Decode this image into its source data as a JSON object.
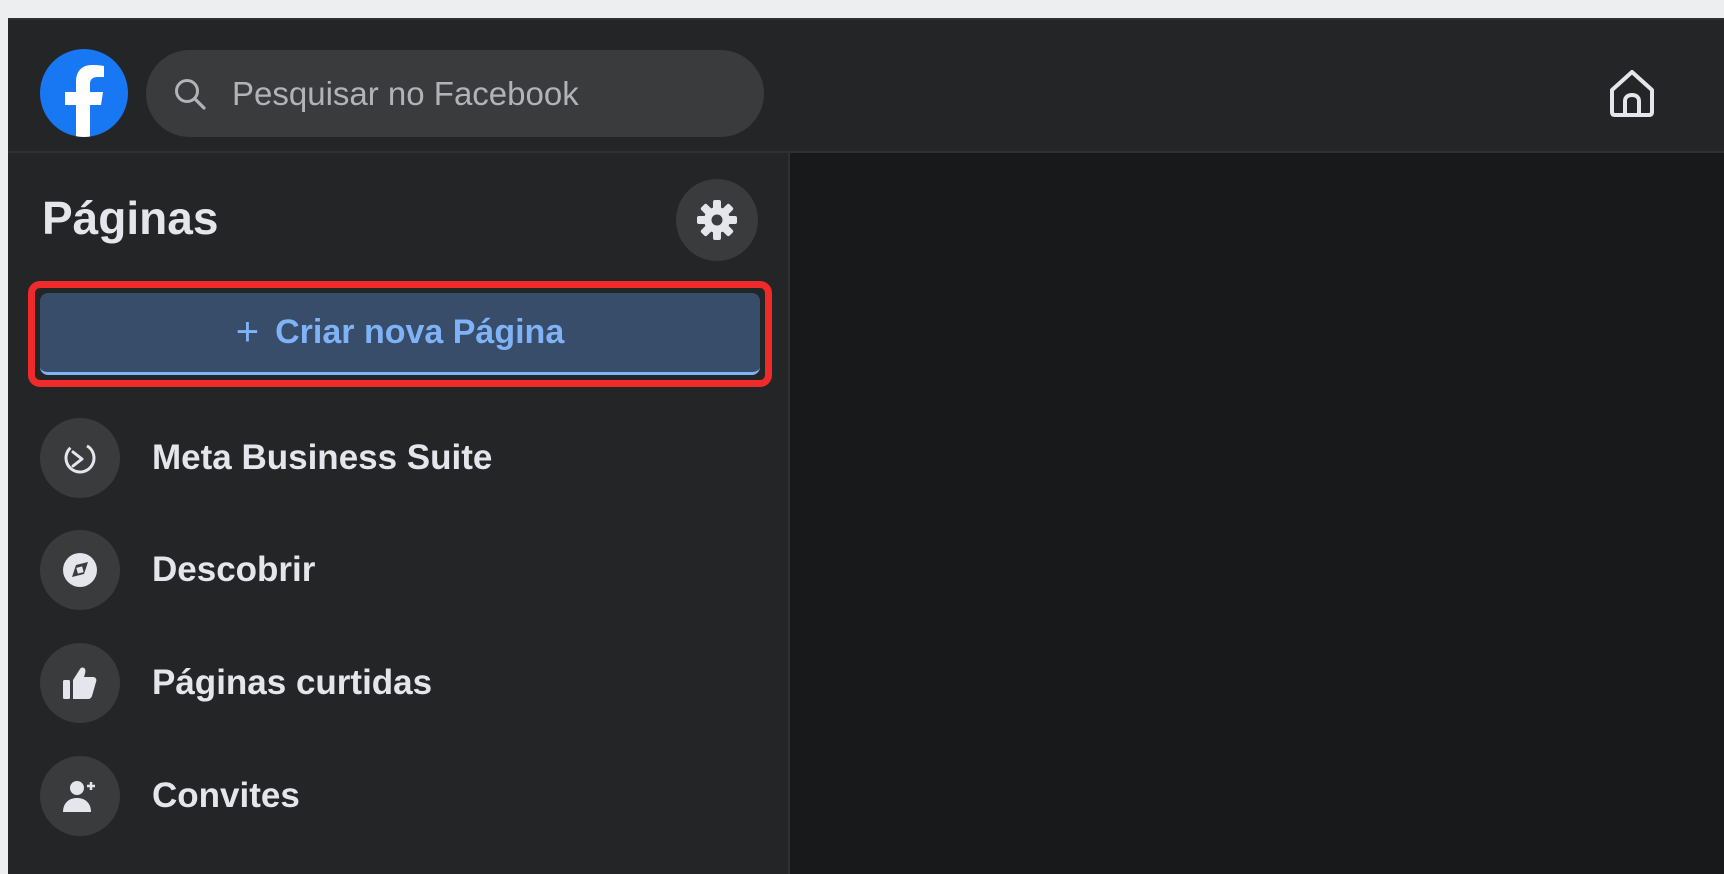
{
  "header": {
    "logo_icon": "facebook-logo-icon",
    "search": {
      "placeholder": "Pesquisar no Facebook",
      "icon": "search-icon"
    },
    "home_icon": "home-icon"
  },
  "sidebar": {
    "title": "Páginas",
    "settings_icon": "gear-icon",
    "create_button": {
      "label": "Criar nova Página",
      "plus": "+"
    },
    "items": [
      {
        "label": "Meta Business Suite",
        "icon": "meta-business-suite-icon"
      },
      {
        "label": "Descobrir",
        "icon": "compass-icon"
      },
      {
        "label": "Páginas curtidas",
        "icon": "thumbs-up-icon"
      },
      {
        "label": "Convites",
        "icon": "add-person-icon"
      }
    ]
  },
  "colors": {
    "background": "#18191a",
    "surface": "#242526",
    "control": "#3a3b3c",
    "brand": "#1877f2",
    "primary_text": "#e4e6eb",
    "secondary_text": "#b0b3b8",
    "create_button_bg": "#374d6a",
    "create_button_text": "#7fb2f7",
    "highlight": "#ee2a2a"
  }
}
